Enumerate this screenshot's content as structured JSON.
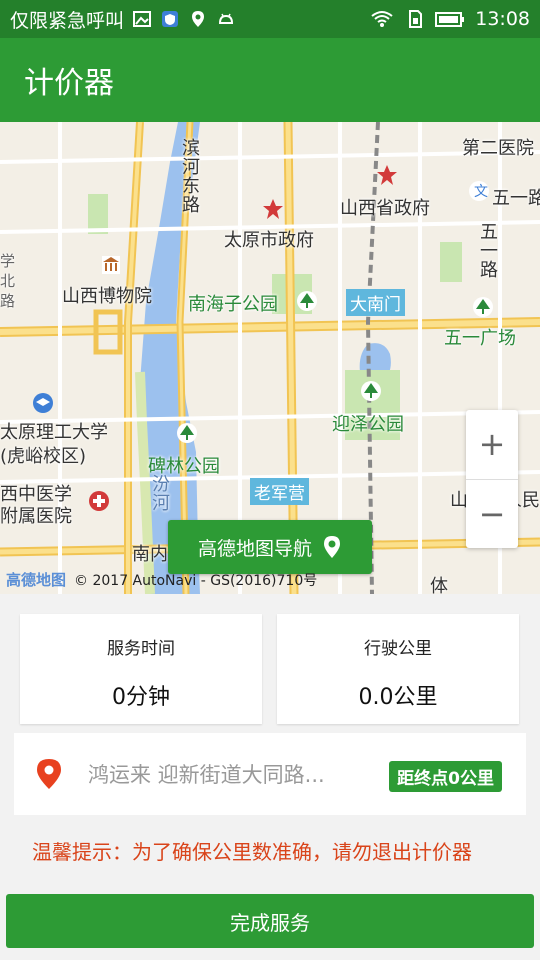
{
  "status_bar": {
    "carrier": "仅限紧急呼叫",
    "time": "13:08",
    "icons": [
      "image-icon",
      "shield-icon",
      "location-icon",
      "android-icon",
      "wifi-icon",
      "sim-icon",
      "battery-icon"
    ]
  },
  "app_bar": {
    "title": "计价器"
  },
  "map": {
    "labels": {
      "binhe_road": "滨河东路",
      "taiyuan_gov": "太原市政府",
      "shanxi_gov": "山西省政府",
      "second_hospital": "第二医院",
      "wuyi_road_short": "五一路",
      "wuyi_road_vertical": "五一路",
      "museum": "山西博物院",
      "nanhaizi_park": "南海子公园",
      "danan_gate": "大南门",
      "wuyi_square": "五一广场",
      "university": "太原理工大学",
      "university_campus": "(虎峪校区)",
      "yingze_park": "迎泽公园",
      "beilin_park": "碑林公园",
      "fen_river": "汾河",
      "laojunying": "老军营",
      "tcm_hospital_1": "西中医学",
      "tcm_hospital_2": "附属医院",
      "provincial_people": "山西省人民",
      "south_road": "南内",
      "ti": "体",
      "left_edge_1": "学",
      "left_edge_2": "北",
      "left_edge_3": "路"
    },
    "nav_button_label": "高德地图导航",
    "zoom_in": "+",
    "zoom_out": "−",
    "logo": "高德地图",
    "copyright": "© 2017 AutoNavi - GS(2016)710号"
  },
  "service_time": {
    "label": "服务时间",
    "value": "0分钟"
  },
  "distance": {
    "label": "行驶公里",
    "value": "0.0公里"
  },
  "destination": {
    "address": "鸿运来 迎新街道大同路...",
    "distance_tag": "距终点0公里"
  },
  "tip": "温馨提示：为了确保公里数准确，请勿退出计价器",
  "finish_button": "完成服务",
  "colors": {
    "primary": "#2d9b35",
    "status": "#24802b",
    "tip": "#d9441a"
  }
}
